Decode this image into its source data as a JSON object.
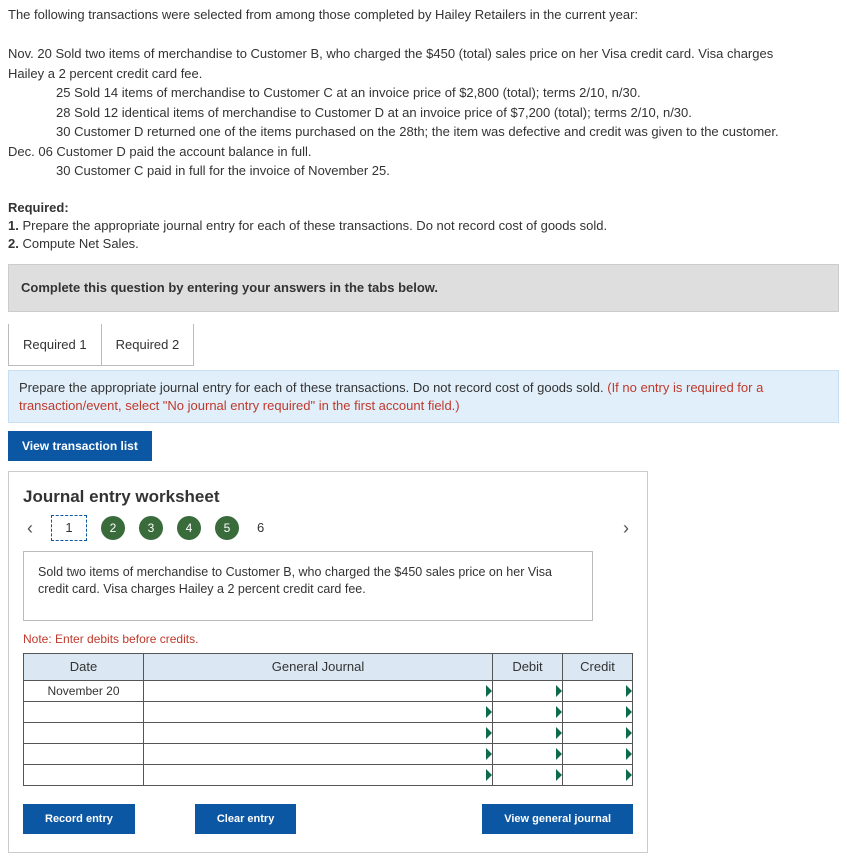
{
  "intro": {
    "line1": "The following transactions were selected from among those completed by Hailey Retailers in the current year:",
    "nov20a": "Nov. 20 Sold two items of merchandise to Customer B, who charged the $450 (total) sales price on her Visa credit card. Visa charges",
    "nov20b": "Hailey a 2 percent credit card fee.",
    "nov25": "25 Sold 14 items of merchandise to Customer C at an invoice price of $2,800 (total); terms 2/10, n/30.",
    "nov28": "28 Sold 12 identical items of merchandise to Customer D at an invoice price of $7,200 (total); terms 2/10, n/30.",
    "nov30": "30 Customer D returned one of the items purchased on the 28th; the item was defective and credit was given to the customer.",
    "dec06": "Dec. 06 Customer D paid the account balance in full.",
    "dec30": "30 Customer C paid in full for the invoice of November 25."
  },
  "required": {
    "heading": "Required:",
    "r1": "1. Prepare the appropriate journal entry for each of these transactions. Do not record cost of goods sold.",
    "r2": "2. Compute Net Sales."
  },
  "grey_bar": "Complete this question by entering your answers in the tabs below.",
  "tabs": {
    "t1": "Required 1",
    "t2": "Required 2"
  },
  "blue_instr": {
    "main": "Prepare the appropriate journal entry for each of these transactions. Do not record cost of goods sold. ",
    "red": "(If no entry is required for a transaction/event, select \"No journal entry required\" in the first account field.)"
  },
  "view_trans": "View transaction list",
  "worksheet": {
    "title": "Journal entry worksheet",
    "steps": [
      "1",
      "2",
      "3",
      "4",
      "5",
      "6"
    ],
    "desc": "Sold two items of merchandise to Customer B, who charged the $450 sales price on her Visa credit card. Visa charges Hailey a 2 percent credit card fee.",
    "note": "Note: Enter debits before credits.",
    "headers": {
      "date": "Date",
      "gj": "General Journal",
      "debit": "Debit",
      "credit": "Credit"
    },
    "row1date": "November 20",
    "buttons": {
      "record": "Record entry",
      "clear": "Clear entry",
      "view": "View general journal"
    }
  }
}
